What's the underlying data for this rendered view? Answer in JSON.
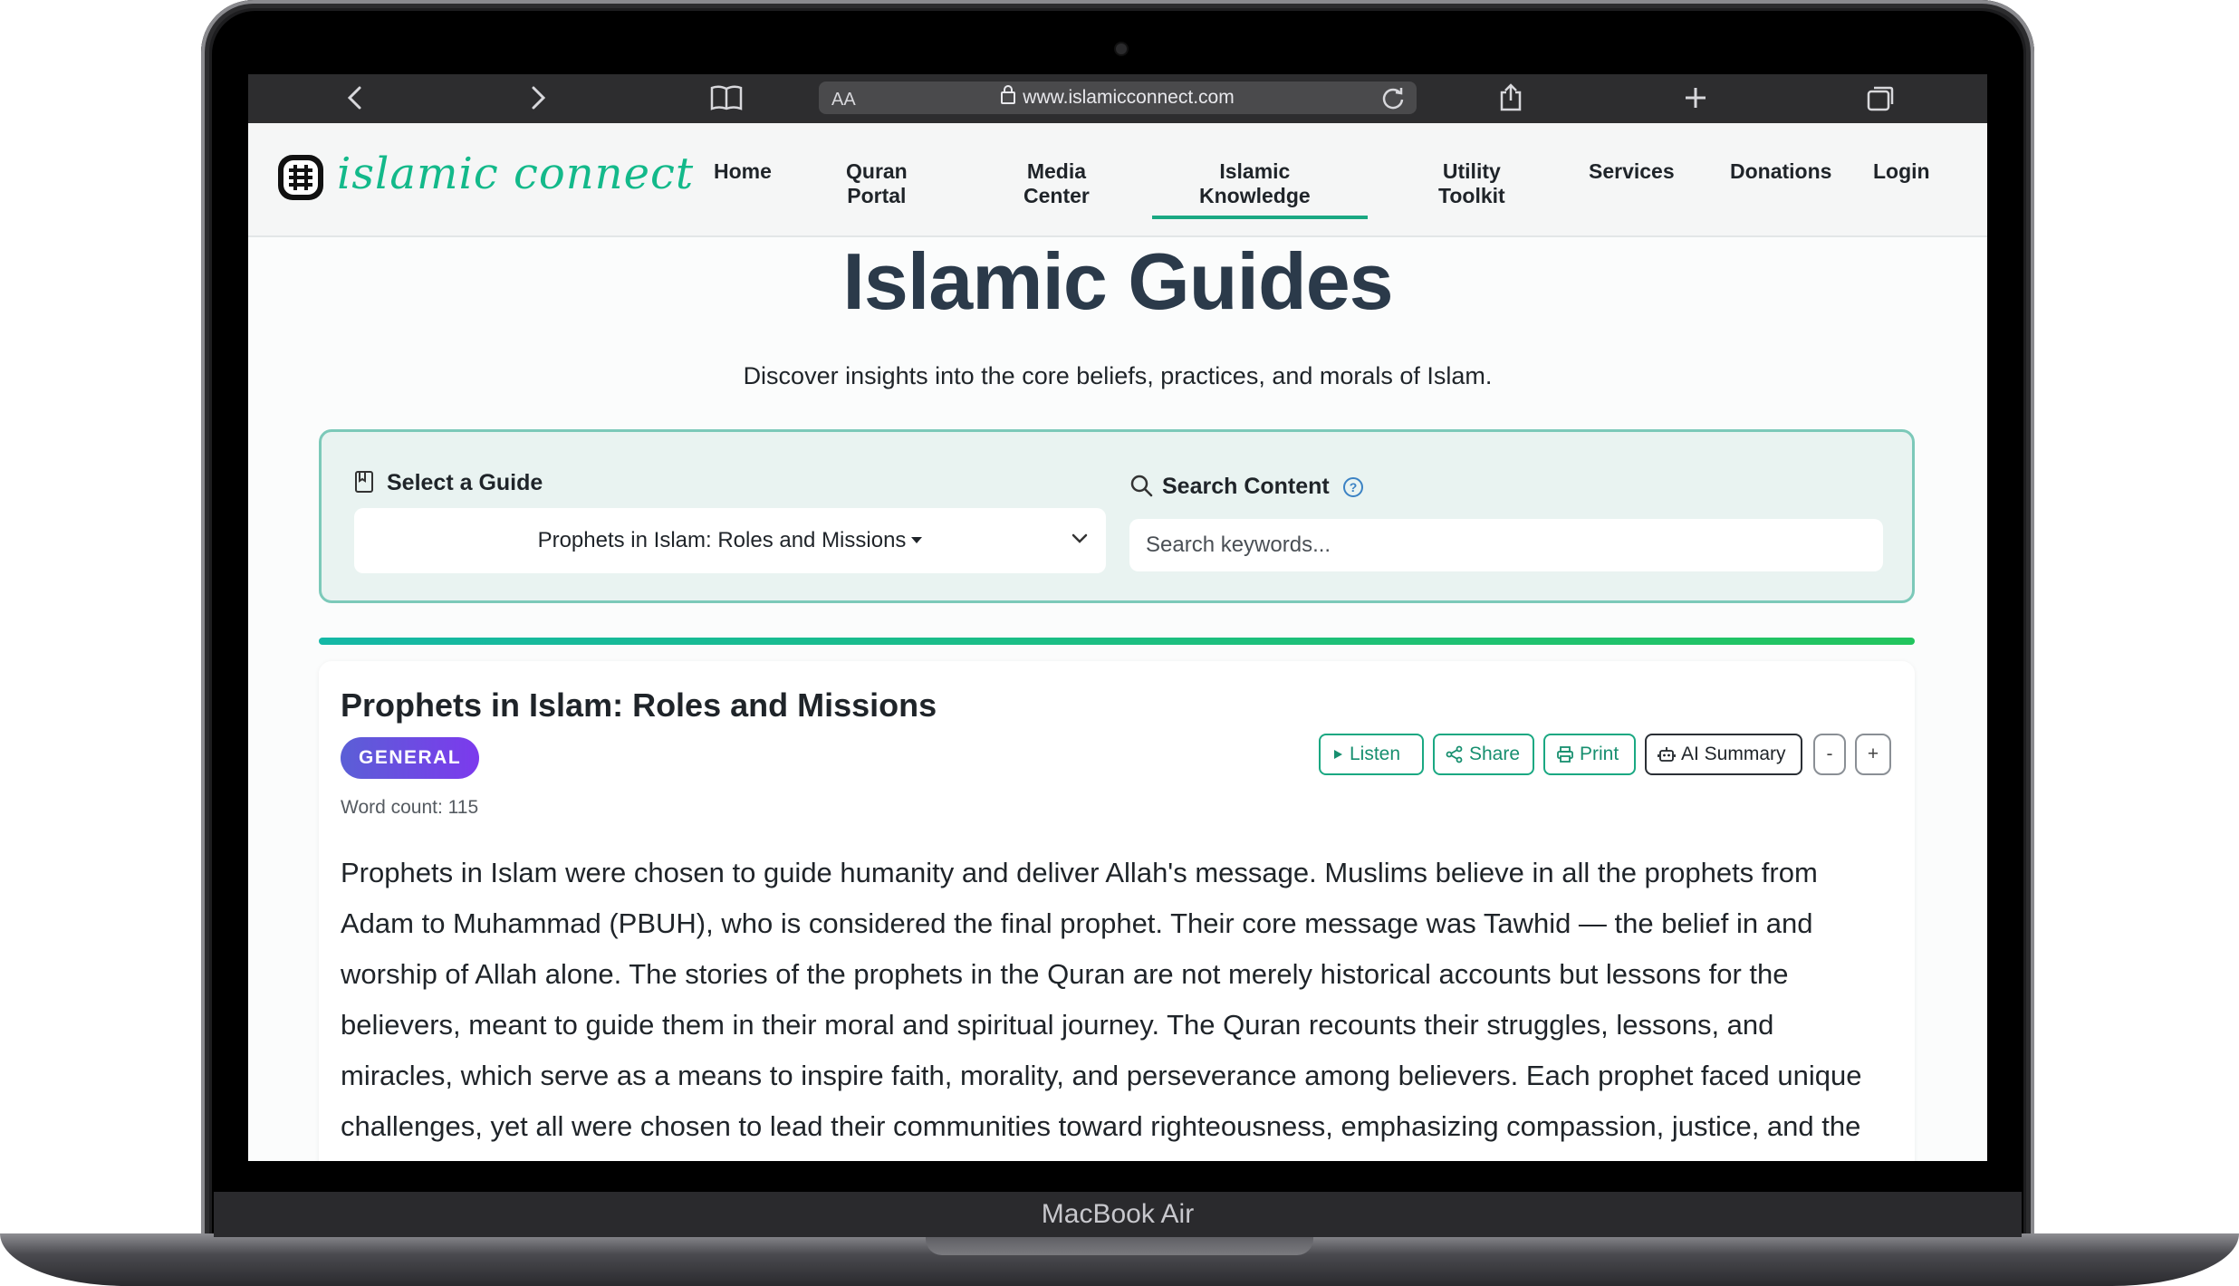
{
  "device": {
    "label": "MacBook Air"
  },
  "browser": {
    "url": "www.islamicconnect.com",
    "reader_label": "AA"
  },
  "site": {
    "logo_text": "islamic connect",
    "nav": {
      "home": "Home",
      "quran_portal_1": "Quran",
      "quran_portal_2": "Portal",
      "media_center_1": "Media",
      "media_center_2": "Center",
      "islamic_knowledge_1": "Islamic",
      "islamic_knowledge_2": "Knowledge",
      "utility_toolkit_1": "Utility",
      "utility_toolkit_2": "Toolkit",
      "services": "Services",
      "donations": "Donations",
      "login": "Login"
    },
    "active_nav": "Islamic Knowledge"
  },
  "hero": {
    "title": "Islamic Guides",
    "subtitle": "Discover insights into the core beliefs, practices, and morals of Islam."
  },
  "selector": {
    "guide_label": "Select a Guide",
    "guide_value": "Prophets in Islam: Roles and Missions",
    "search_label": "Search Content",
    "search_placeholder": "Search keywords...",
    "search_value": "",
    "help_symbol": "?"
  },
  "progress": {
    "value": 1.0
  },
  "guide": {
    "title": "Prophets in Islam: Roles and Missions",
    "category": "GENERAL",
    "word_count": "Word count: 115",
    "actions": {
      "listen": "Listen",
      "share": "Share",
      "print": "Print",
      "ai_summary": "AI Summary",
      "decrease": "-",
      "increase": "+"
    },
    "body": "Prophets in Islam were chosen to guide humanity and deliver Allah's message. Muslims believe in all the prophets from Adam to Muhammad (PBUH), who is considered the final prophet. Their core message was Tawhid — the belief in and worship of Allah alone. The stories of the prophets in the Quran are not merely historical accounts but lessons for the believers, meant to guide them in their moral and spiritual journey. The Quran recounts their struggles, lessons, and miracles, which serve as a means to inspire faith, morality, and perseverance among believers. Each prophet faced unique challenges, yet all were chosen to lead their communities toward righteousness, emphasizing compassion, justice, and the worship of Allah."
  },
  "colors": {
    "brand": "#13b98a",
    "title": "#2b3a4a",
    "panel_bg": "#e9f3f1",
    "panel_border": "#7cc9b9",
    "badge": "#6d4ae0"
  }
}
